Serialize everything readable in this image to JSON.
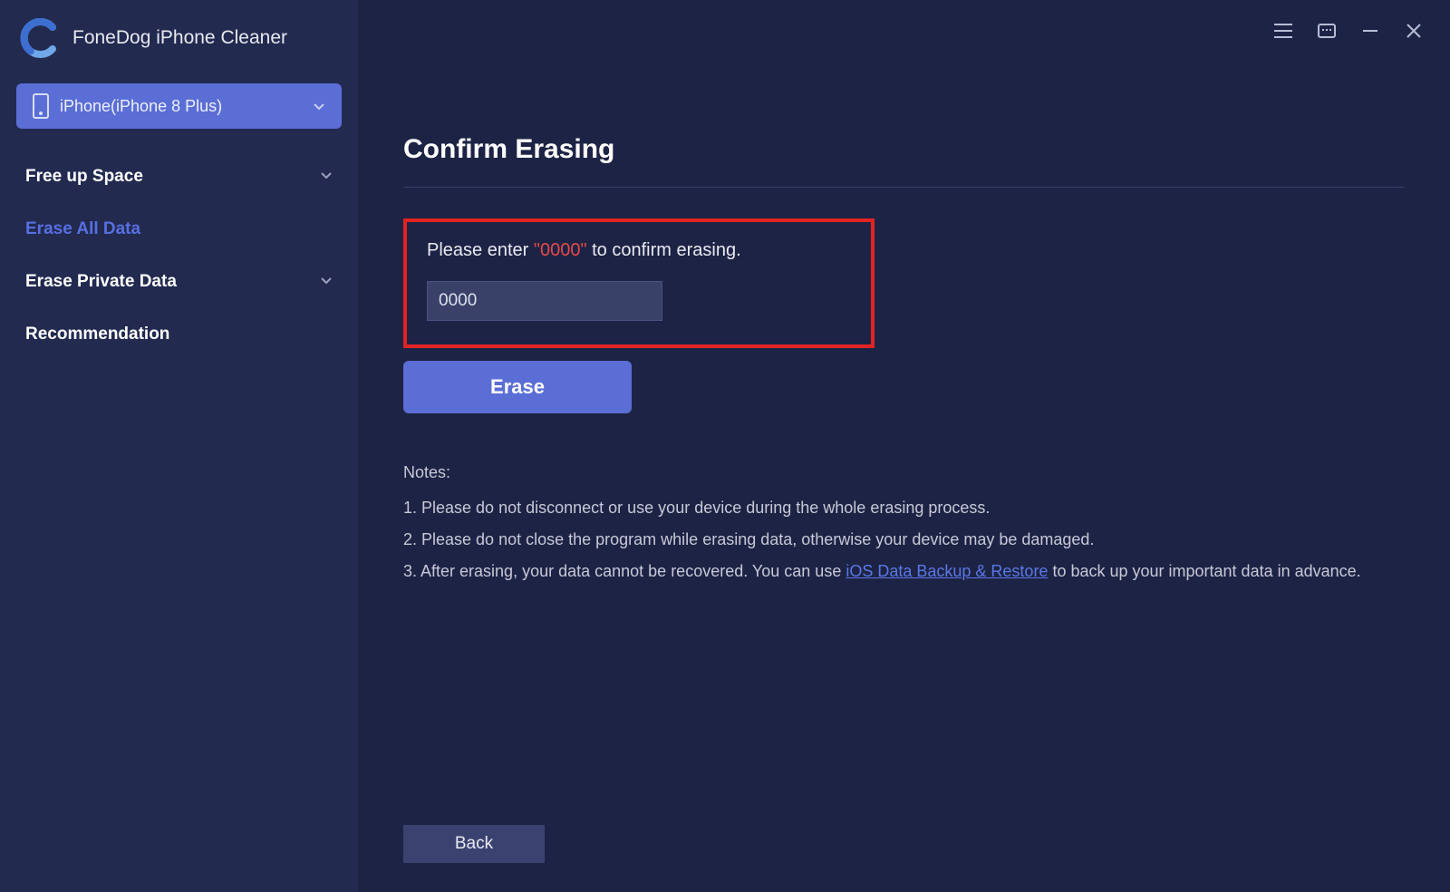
{
  "app": {
    "title": "FoneDog iPhone Cleaner"
  },
  "device": {
    "label": "iPhone(iPhone 8 Plus)"
  },
  "nav": {
    "freeUpSpace": "Free up Space",
    "eraseAllData": "Erase All Data",
    "erasePrivateData": "Erase Private Data",
    "recommendation": "Recommendation"
  },
  "main": {
    "title": "Confirm Erasing",
    "promptBefore": "Please enter ",
    "promptCode": "\"0000\"",
    "promptAfter": " to confirm erasing.",
    "inputValue": "0000",
    "eraseLabel": "Erase",
    "backLabel": "Back"
  },
  "notes": {
    "heading": "Notes:",
    "n1": "1. Please do not disconnect or use your device during the whole erasing process.",
    "n2": "2. Please do not close the program while erasing data, otherwise your device may be damaged.",
    "n3before": "3. After erasing, your data cannot be recovered. You can use ",
    "n3link": "iOS Data Backup & Restore",
    "n3after": " to back up your important data in advance."
  }
}
